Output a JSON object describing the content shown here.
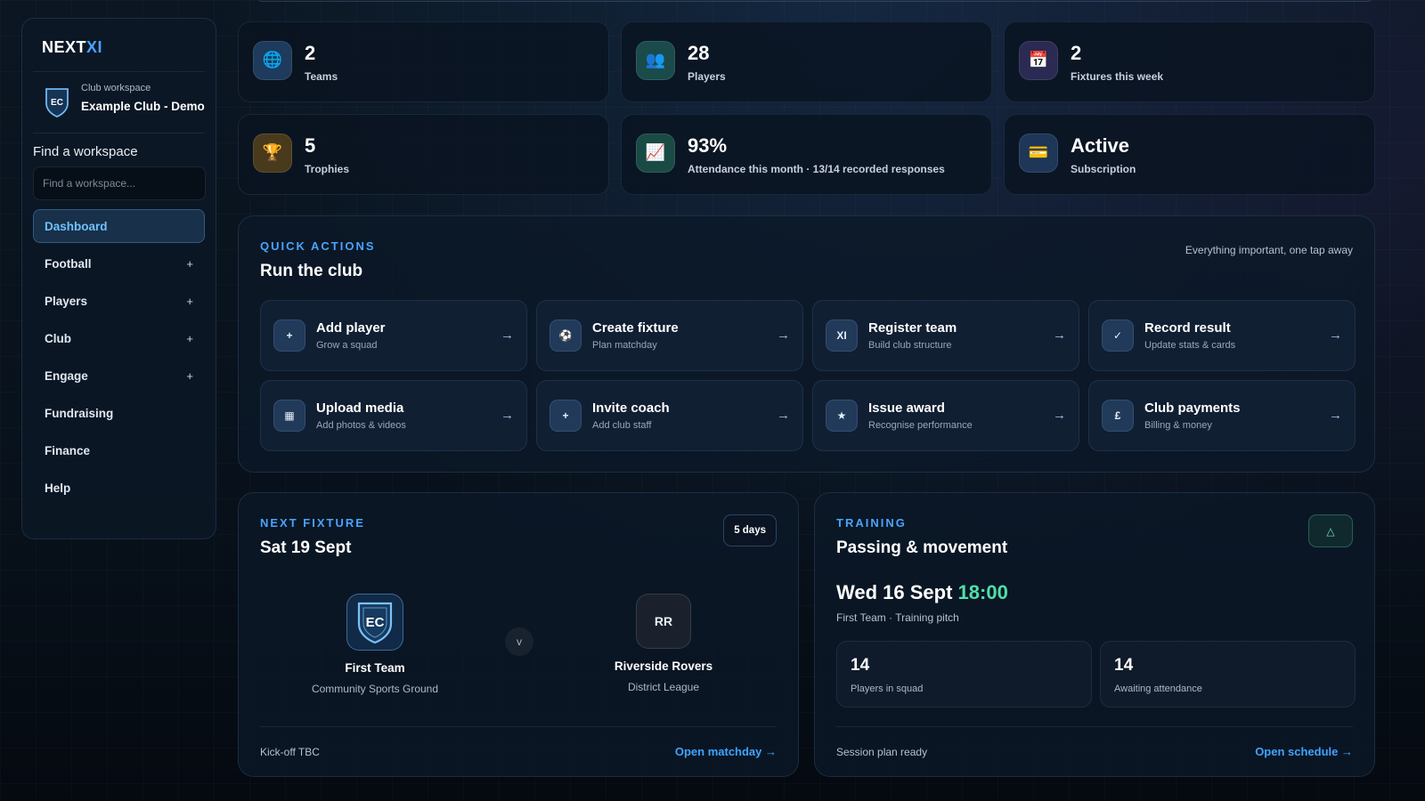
{
  "brand": {
    "prefix": "NEXT",
    "suffix": "XI"
  },
  "workspace": {
    "caption": "Club workspace",
    "name": "Example Club - Demo",
    "crest_initials": "EC"
  },
  "search": {
    "label": "Find a workspace",
    "placeholder": "Find a workspace..."
  },
  "nav": [
    {
      "label": "Dashboard",
      "active": true,
      "expandable": false
    },
    {
      "label": "Football",
      "expandable": true
    },
    {
      "label": "Players",
      "expandable": true
    },
    {
      "label": "Club",
      "expandable": true
    },
    {
      "label": "Engage",
      "expandable": true
    },
    {
      "label": "Fundraising",
      "expandable": false
    },
    {
      "label": "Finance",
      "expandable": false
    },
    {
      "label": "Help",
      "expandable": false
    }
  ],
  "nav_plus_symbol": "+",
  "stats": [
    {
      "value": "2",
      "label": "Teams",
      "icon": "globe-icon",
      "glyph": "🌐",
      "color": "#1e3a5c"
    },
    {
      "value": "28",
      "label": "Players",
      "icon": "people-icon",
      "glyph": "👥",
      "color": "#1a4a4a"
    },
    {
      "value": "2",
      "label": "Fixtures this week",
      "icon": "calendar-icon",
      "glyph": "📅",
      "color": "#2a2a52"
    },
    {
      "value": "5",
      "label": "Trophies",
      "icon": "trophy-icon",
      "glyph": "🏆",
      "color": "#4a3a1c"
    },
    {
      "value": "93%",
      "label": "Attendance this month · 13/14 recorded responses",
      "icon": "chart-icon",
      "glyph": "📈",
      "color": "#1a4a44"
    },
    {
      "value": "Active",
      "label": "Subscription",
      "icon": "card-icon",
      "glyph": "💳",
      "color": "#1e3658"
    }
  ],
  "quick_actions": {
    "eyebrow": "QUICK ACTIONS",
    "title": "Run the club",
    "tagline": "Everything important, one tap away",
    "arrow": "→",
    "items": [
      {
        "title": "Add player",
        "sub": "Grow a squad",
        "icon": "plus-icon",
        "glyph": "+"
      },
      {
        "title": "Create fixture",
        "sub": "Plan matchday",
        "icon": "ball-icon",
        "glyph": "⚽"
      },
      {
        "title": "Register team",
        "sub": "Build club structure",
        "icon": "xi-icon",
        "glyph": "XI"
      },
      {
        "title": "Record result",
        "sub": "Update stats & cards",
        "icon": "check-icon",
        "glyph": "✓"
      },
      {
        "title": "Upload media",
        "sub": "Add photos & videos",
        "icon": "image-icon",
        "glyph": "▦"
      },
      {
        "title": "Invite coach",
        "sub": "Add club staff",
        "icon": "plus-icon",
        "glyph": "+"
      },
      {
        "title": "Issue award",
        "sub": "Recognise performance",
        "icon": "star-icon",
        "glyph": "★"
      },
      {
        "title": "Club payments",
        "sub": "Billing & money",
        "icon": "pound-icon",
        "glyph": "£"
      }
    ]
  },
  "next_fixture": {
    "eyebrow": "NEXT FIXTURE",
    "date": "Sat 19 Sept",
    "countdown": "5 days",
    "home": {
      "initials": "EC",
      "name": "First Team",
      "venue": "Community Sports Ground"
    },
    "versus": "v",
    "away": {
      "initials": "RR",
      "name": "Riverside Rovers",
      "league": "District League"
    },
    "kickoff": "Kick-off TBC",
    "link": "Open matchday →"
  },
  "training": {
    "eyebrow": "TRAINING",
    "title": "Passing & movement",
    "day": "Wed 16 Sept",
    "time": "18:00",
    "where": "First Team · Training pitch",
    "toggle_glyph": "△",
    "stats": [
      {
        "value": "14",
        "label": "Players in squad"
      },
      {
        "value": "14",
        "label": "Awaiting attendance"
      }
    ],
    "status": "Session plan ready",
    "link": "Open schedule →"
  },
  "colors": {
    "accent": "#4aa3ff",
    "time_green": "#4fe0a8",
    "link": "#3fa4ff"
  }
}
